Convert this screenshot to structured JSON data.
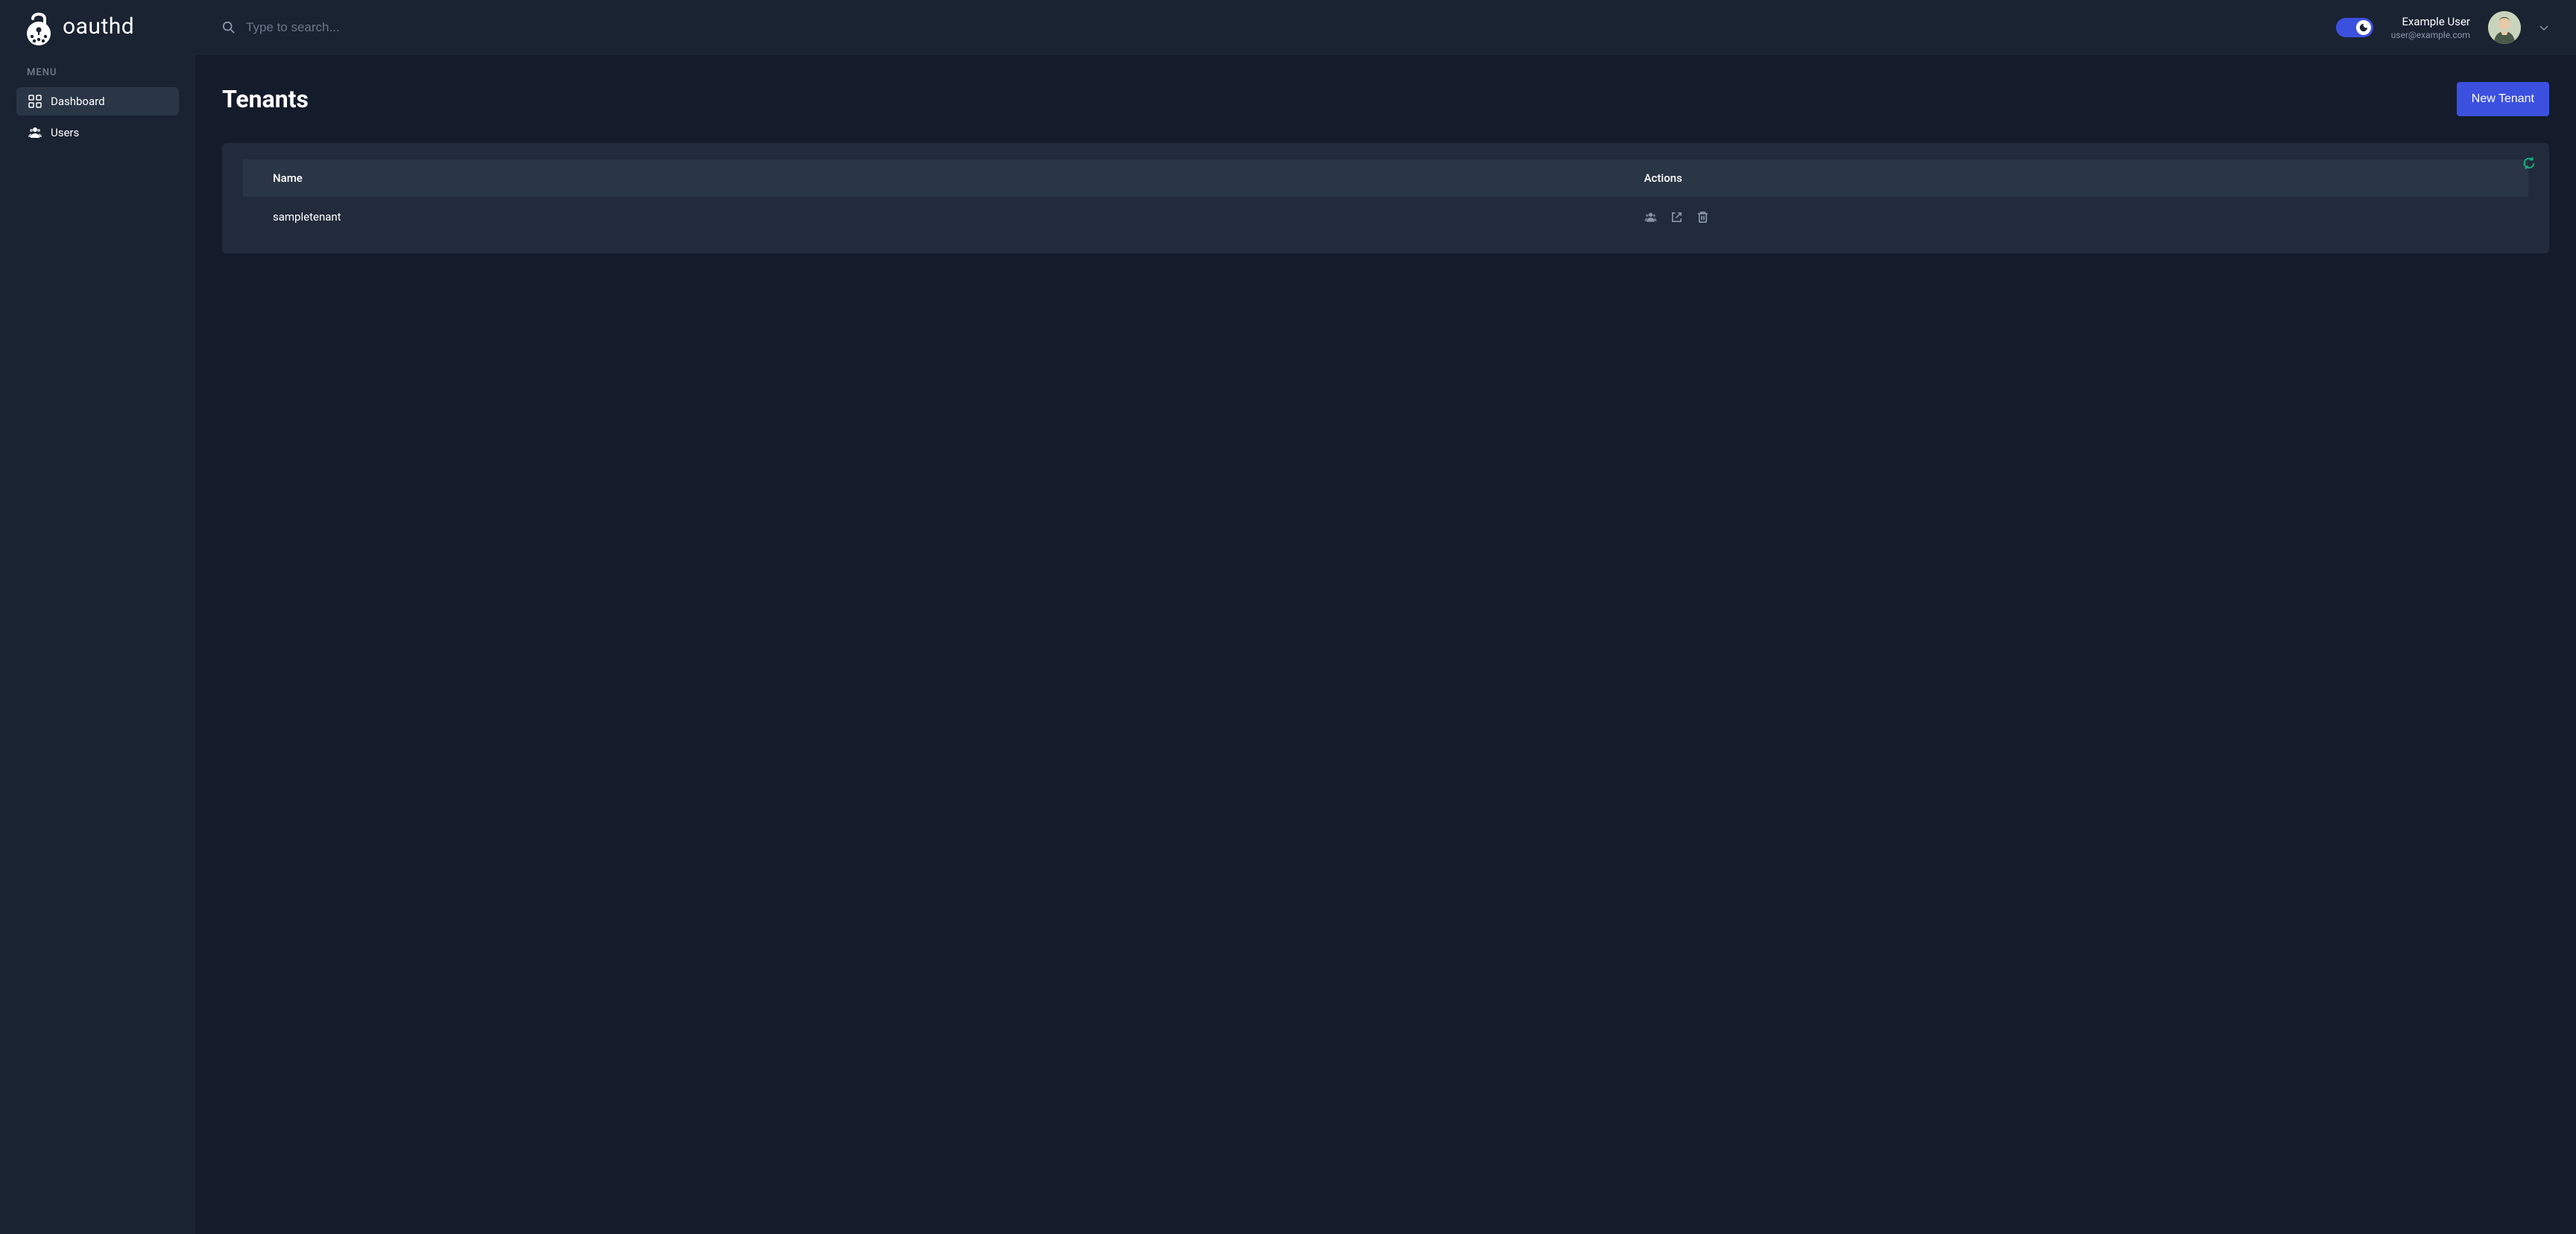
{
  "brand": {
    "name": "oauthd"
  },
  "sidebar": {
    "menu_label": "MENU",
    "items": [
      {
        "label": "Dashboard",
        "active": true
      },
      {
        "label": "Users",
        "active": false
      }
    ]
  },
  "header": {
    "search_placeholder": "Type to search...",
    "user": {
      "name": "Example User",
      "email": "user@example.com"
    }
  },
  "page": {
    "title": "Tenants",
    "new_button": "New Tenant"
  },
  "table": {
    "columns": {
      "name": "Name",
      "actions": "Actions"
    },
    "rows": [
      {
        "name": "sampletenant"
      }
    ]
  }
}
